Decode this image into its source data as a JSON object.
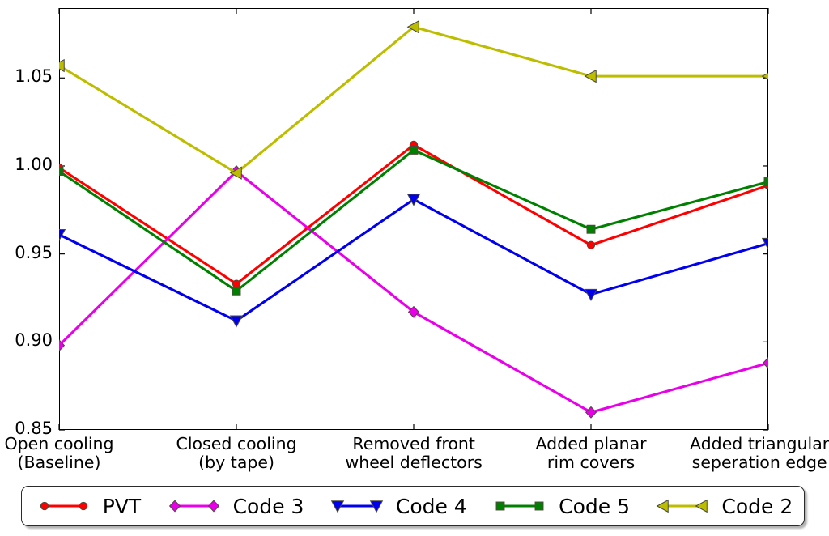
{
  "chart_data": {
    "type": "line",
    "title": "",
    "xlabel": "",
    "ylabel": "",
    "categories": [
      "Open cooling\n(Baseline)",
      "Closed cooling\n(by tape)",
      "Removed front\nwheel deflectors",
      "Added planar\nrim covers",
      "Added triangular\nseperation edge"
    ],
    "category_lines": [
      [
        "Open cooling",
        "(Baseline)"
      ],
      [
        "Closed cooling",
        "(by tape)"
      ],
      [
        "Removed front",
        "wheel deflectors"
      ],
      [
        "Added planar",
        "rim covers"
      ],
      [
        "Added triangular",
        "seperation edge"
      ]
    ],
    "ylim": [
      0.85,
      1.0897
    ],
    "yticks": [
      0.85,
      0.9,
      0.95,
      1.0,
      1.05
    ],
    "ytick_labels": [
      "0.85",
      "0.90",
      "0.95",
      "1.00",
      "1.05"
    ],
    "grid": false,
    "legend_position": "below-axes",
    "series": [
      {
        "name": "PVT",
        "color": "#FF0000",
        "marker": "circle",
        "values": [
          0.999,
          0.933,
          1.012,
          0.955,
          0.989
        ]
      },
      {
        "name": "Code 3",
        "color": "#E800E8",
        "marker": "diamond",
        "values": [
          0.898,
          0.997,
          0.917,
          0.86,
          0.888
        ]
      },
      {
        "name": "Code 4",
        "color": "#0000EE",
        "marker": "triangle-down",
        "values": [
          0.961,
          0.912,
          0.981,
          0.927,
          0.956
        ]
      },
      {
        "name": "Code 5",
        "color": "#008000",
        "marker": "square",
        "values": [
          0.997,
          0.929,
          1.009,
          0.964,
          0.991
        ]
      },
      {
        "name": "Code 2",
        "color": "#BDBD00",
        "marker": "triangle-left",
        "values": [
          1.057,
          0.996,
          1.079,
          1.051,
          1.051
        ]
      }
    ]
  },
  "legend": {
    "entries": [
      {
        "label": "PVT"
      },
      {
        "label": "Code 3"
      },
      {
        "label": "Code 4"
      },
      {
        "label": "Code 5"
      },
      {
        "label": "Code 2"
      }
    ]
  }
}
